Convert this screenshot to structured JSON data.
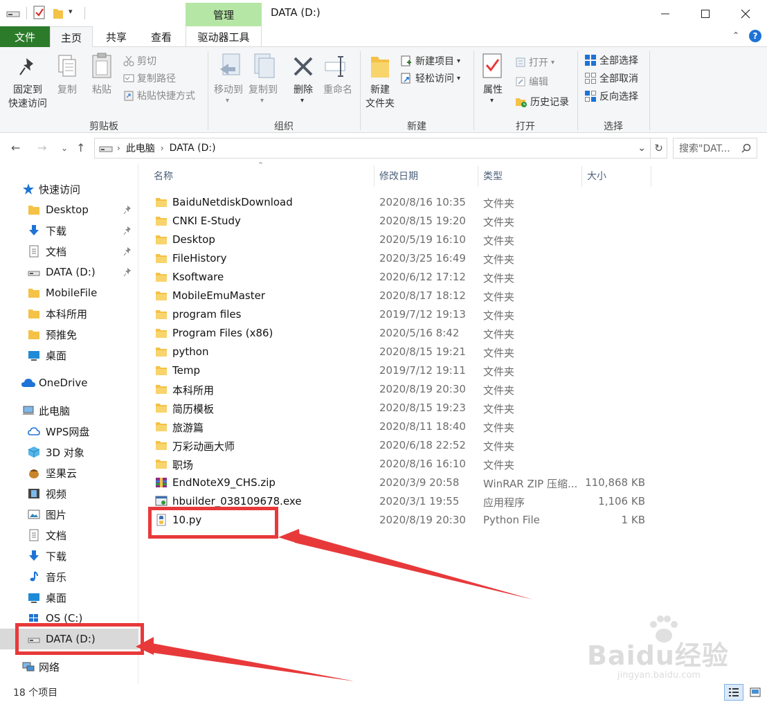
{
  "titlebar": {
    "manage_tab": "管理",
    "title": "DATA (D:)",
    "minimize": "—",
    "maximize": "☐",
    "close": "✕"
  },
  "tabs": {
    "file": "文件",
    "home": "主页",
    "share": "共享",
    "view": "查看",
    "drive_tools": "驱动器工具"
  },
  "ribbon": {
    "clipboard": {
      "label": "剪贴板",
      "pin": "固定到\n快速访问",
      "copy": "复制",
      "paste": "粘贴",
      "cut": "剪切",
      "copy_path": "复制路径",
      "paste_shortcut": "粘贴快捷方式"
    },
    "organize": {
      "label": "组织",
      "move_to": "移动到",
      "copy_to": "复制到",
      "delete": "删除",
      "rename": "重命名"
    },
    "new": {
      "label": "新建",
      "new_folder": "新建\n文件夹",
      "new_item": "新建项目",
      "easy_access": "轻松访问"
    },
    "open": {
      "label": "打开",
      "properties": "属性",
      "open": "打开",
      "edit": "编辑",
      "history": "历史记录"
    },
    "select": {
      "label": "选择",
      "select_all": "全部选择",
      "select_none": "全部取消",
      "invert": "反向选择"
    }
  },
  "address": {
    "crumbs": [
      "此电脑",
      "DATA (D:)"
    ],
    "search_placeholder": "搜索\"DAT..."
  },
  "navpane": {
    "quick_access": "快速访问",
    "quick_items": [
      "Desktop",
      "下载",
      "文档",
      "DATA (D:)",
      "MobileFile",
      "本科所用",
      "预推免",
      "桌面"
    ],
    "onedrive": "OneDrive",
    "this_pc": "此电脑",
    "pc_items": [
      "WPS网盘",
      "3D 对象",
      "坚果云",
      "视频",
      "图片",
      "文档",
      "下载",
      "音乐",
      "桌面",
      "OS (C:)",
      "DATA (D:)"
    ],
    "network": "网络"
  },
  "columns": {
    "name": "名称",
    "date": "修改日期",
    "type": "类型",
    "size": "大小"
  },
  "files": [
    {
      "name": "BaiduNetdiskDownload",
      "date": "2020/8/16 10:35",
      "type": "文件夹",
      "size": "",
      "kind": "folder"
    },
    {
      "name": "CNKI E-Study",
      "date": "2020/8/15 19:20",
      "type": "文件夹",
      "size": "",
      "kind": "folder"
    },
    {
      "name": "Desktop",
      "date": "2020/5/19 16:10",
      "type": "文件夹",
      "size": "",
      "kind": "folder"
    },
    {
      "name": "FileHistory",
      "date": "2020/3/25 16:49",
      "type": "文件夹",
      "size": "",
      "kind": "folder"
    },
    {
      "name": "Ksoftware",
      "date": "2020/6/12 17:12",
      "type": "文件夹",
      "size": "",
      "kind": "folder"
    },
    {
      "name": "MobileEmuMaster",
      "date": "2020/8/17 18:12",
      "type": "文件夹",
      "size": "",
      "kind": "folder"
    },
    {
      "name": "program files",
      "date": "2019/7/12 19:13",
      "type": "文件夹",
      "size": "",
      "kind": "folder"
    },
    {
      "name": "Program Files (x86)",
      "date": "2020/5/16 8:42",
      "type": "文件夹",
      "size": "",
      "kind": "folder"
    },
    {
      "name": "python",
      "date": "2020/8/15 19:21",
      "type": "文件夹",
      "size": "",
      "kind": "folder"
    },
    {
      "name": "Temp",
      "date": "2019/7/12 19:11",
      "type": "文件夹",
      "size": "",
      "kind": "folder"
    },
    {
      "name": "本科所用",
      "date": "2020/8/19 20:30",
      "type": "文件夹",
      "size": "",
      "kind": "folder"
    },
    {
      "name": "简历模板",
      "date": "2020/8/15 19:23",
      "type": "文件夹",
      "size": "",
      "kind": "folder"
    },
    {
      "name": "旅游篇",
      "date": "2020/8/11 18:40",
      "type": "文件夹",
      "size": "",
      "kind": "folder"
    },
    {
      "name": "万彩动画大师",
      "date": "2020/6/18 22:52",
      "type": "文件夹",
      "size": "",
      "kind": "folder"
    },
    {
      "name": "职场",
      "date": "2020/8/16 16:10",
      "type": "文件夹",
      "size": "",
      "kind": "folder"
    },
    {
      "name": "EndNoteX9_CHS.zip",
      "date": "2020/3/9 20:58",
      "type": "WinRAR ZIP 压缩...",
      "size": "110,868 KB",
      "kind": "zip"
    },
    {
      "name": "hbuilder_038109678.exe",
      "date": "2020/3/1 19:55",
      "type": "应用程序",
      "size": "1,106 KB",
      "kind": "exe"
    },
    {
      "name": "10.py",
      "date": "2020/8/19 20:30",
      "type": "Python File",
      "size": "1 KB",
      "kind": "py"
    }
  ],
  "status": {
    "count": "18 个项目"
  },
  "watermark": {
    "brand": "Baidu经验",
    "url": "jingyan.baidu.com"
  },
  "colors": {
    "file_tab": "#2c7b2b",
    "manage_tab": "#b6e6a5",
    "highlight": "#e8393a",
    "folder": "#f4c246"
  }
}
